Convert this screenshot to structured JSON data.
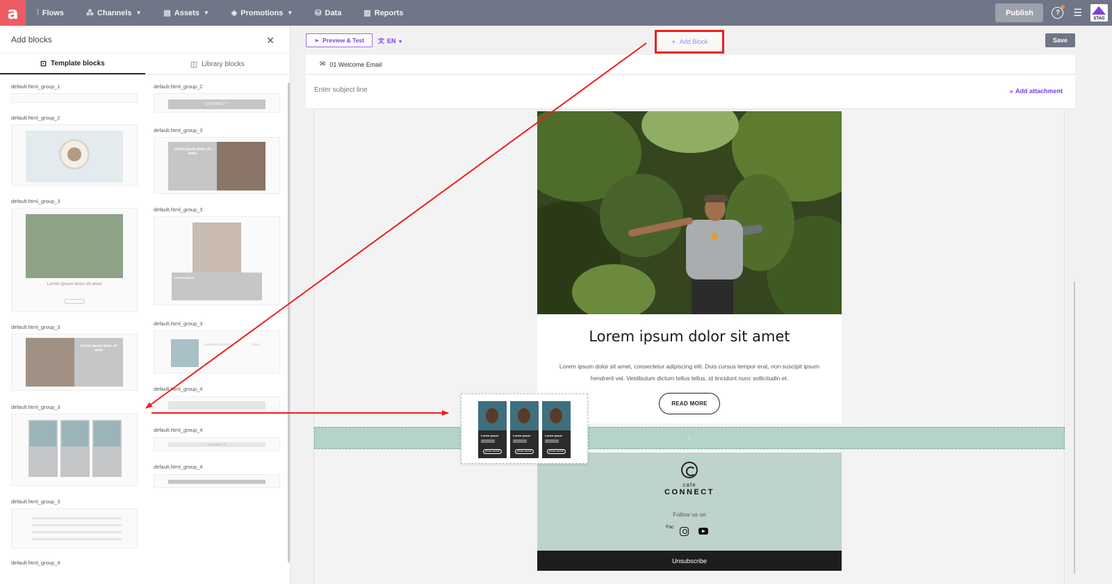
{
  "app": {
    "logo_glyph": "a",
    "colors": {
      "nav_bg": "#6f7687",
      "logo_bg": "#ef5b63",
      "accent": "#7b3fe4",
      "annotation": "#ee1c1c",
      "drop_zone": "#b3d4c6",
      "footer_bg": "#bed3cb"
    }
  },
  "nav": {
    "items": [
      {
        "label": "Flows",
        "icon": "flows-icon",
        "dropdown": false
      },
      {
        "label": "Channels",
        "icon": "channels-icon",
        "dropdown": true
      },
      {
        "label": "Assets",
        "icon": "assets-icon",
        "dropdown": true
      },
      {
        "label": "Promotions",
        "icon": "promotions-icon",
        "dropdown": true
      },
      {
        "label": "Data",
        "icon": "database-icon",
        "dropdown": false
      },
      {
        "label": "Reports",
        "icon": "reports-icon",
        "dropdown": false
      }
    ],
    "publish_label": "Publish",
    "help_glyph": "?",
    "env_badge": "STAG"
  },
  "left_panel": {
    "title": "Add blocks",
    "tabs": [
      {
        "label": "Template blocks",
        "active": true
      },
      {
        "label": "Library blocks",
        "active": false
      }
    ],
    "blocks": [
      "default.html_group_1",
      "default.html_group_2",
      "default.html_group_3",
      "default.html_group_3",
      "default.html_group_3",
      "default.html_group_3",
      "default.html_group_4",
      "default.html_group_2",
      "default.html_group_3",
      "default.html_group_3",
      "default.html_group_3",
      "default.html_group_4",
      "default.html_group_4",
      "default.html_group_4"
    ],
    "thumb_texts": {
      "connect": "CONNECT",
      "lorem_heading": "Lorem ipsum dolor sit amet",
      "read_more": "READ MORE",
      "lorem_ipsum": "Lorem ipsum"
    }
  },
  "editor": {
    "preview_label": "Preview & Test",
    "language": "EN",
    "add_block_label": "Add Block",
    "save_label": "Save",
    "email_name": "01 Welcome Email",
    "subject_placeholder": "Enter subject line",
    "attachment_label": "Add attachment"
  },
  "email": {
    "headline": "Lorem ipsum dolor sit amet",
    "body": "Lorem ipsum dolor sit amet, consectetur adipiscing elit. Duis cursus tempor erat, non suscipit ipsum hendrerit vel. Vestibulum dictum tellus tellus, id tincidunt nunc sollicitudin et.",
    "cta": "READ MORE",
    "drop_hint": "+",
    "footer": {
      "brand_small": "cafe",
      "brand_big": "CONNECT",
      "follow": "Follow us on",
      "facebook_alt": "Fac",
      "unsubscribe": "Unsubscribe"
    }
  },
  "drag_ghost": {
    "cards": [
      {
        "title": "Lorem ipsum",
        "button": "READ MORE"
      },
      {
        "title": "Lorem ipsum",
        "button": "READ MORE"
      },
      {
        "title": "Lorem ipsum",
        "button": "READ MORE"
      }
    ]
  }
}
